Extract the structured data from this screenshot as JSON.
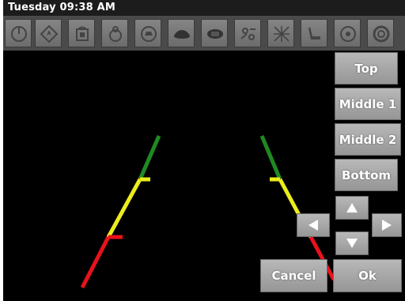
{
  "status_bar": {
    "time_label": "Tuesday 09:38 AM"
  },
  "icon_bar": {
    "icons": [
      "power-icon",
      "navigation-icon",
      "phone-icon",
      "music-icon",
      "car-front-icon",
      "car-side-icon",
      "settings-icon",
      "network-icon",
      "seat-icon",
      "wheel-icon",
      "tire-icon"
    ]
  },
  "controls": {
    "top_label": "Top",
    "middle1_label": "Middle 1",
    "middle2_label": "Middle 2",
    "bottom_label": "Bottom",
    "cancel_label": "Cancel",
    "ok_label": "Ok"
  },
  "arrows": [
    "arrow-up-icon",
    "arrow-left-icon",
    "arrow-down-icon",
    "arrow-right-icon"
  ],
  "guide_line_colors": {
    "far": "#1f8a22",
    "middle": "#ecec1e",
    "near": "#e8121c"
  }
}
